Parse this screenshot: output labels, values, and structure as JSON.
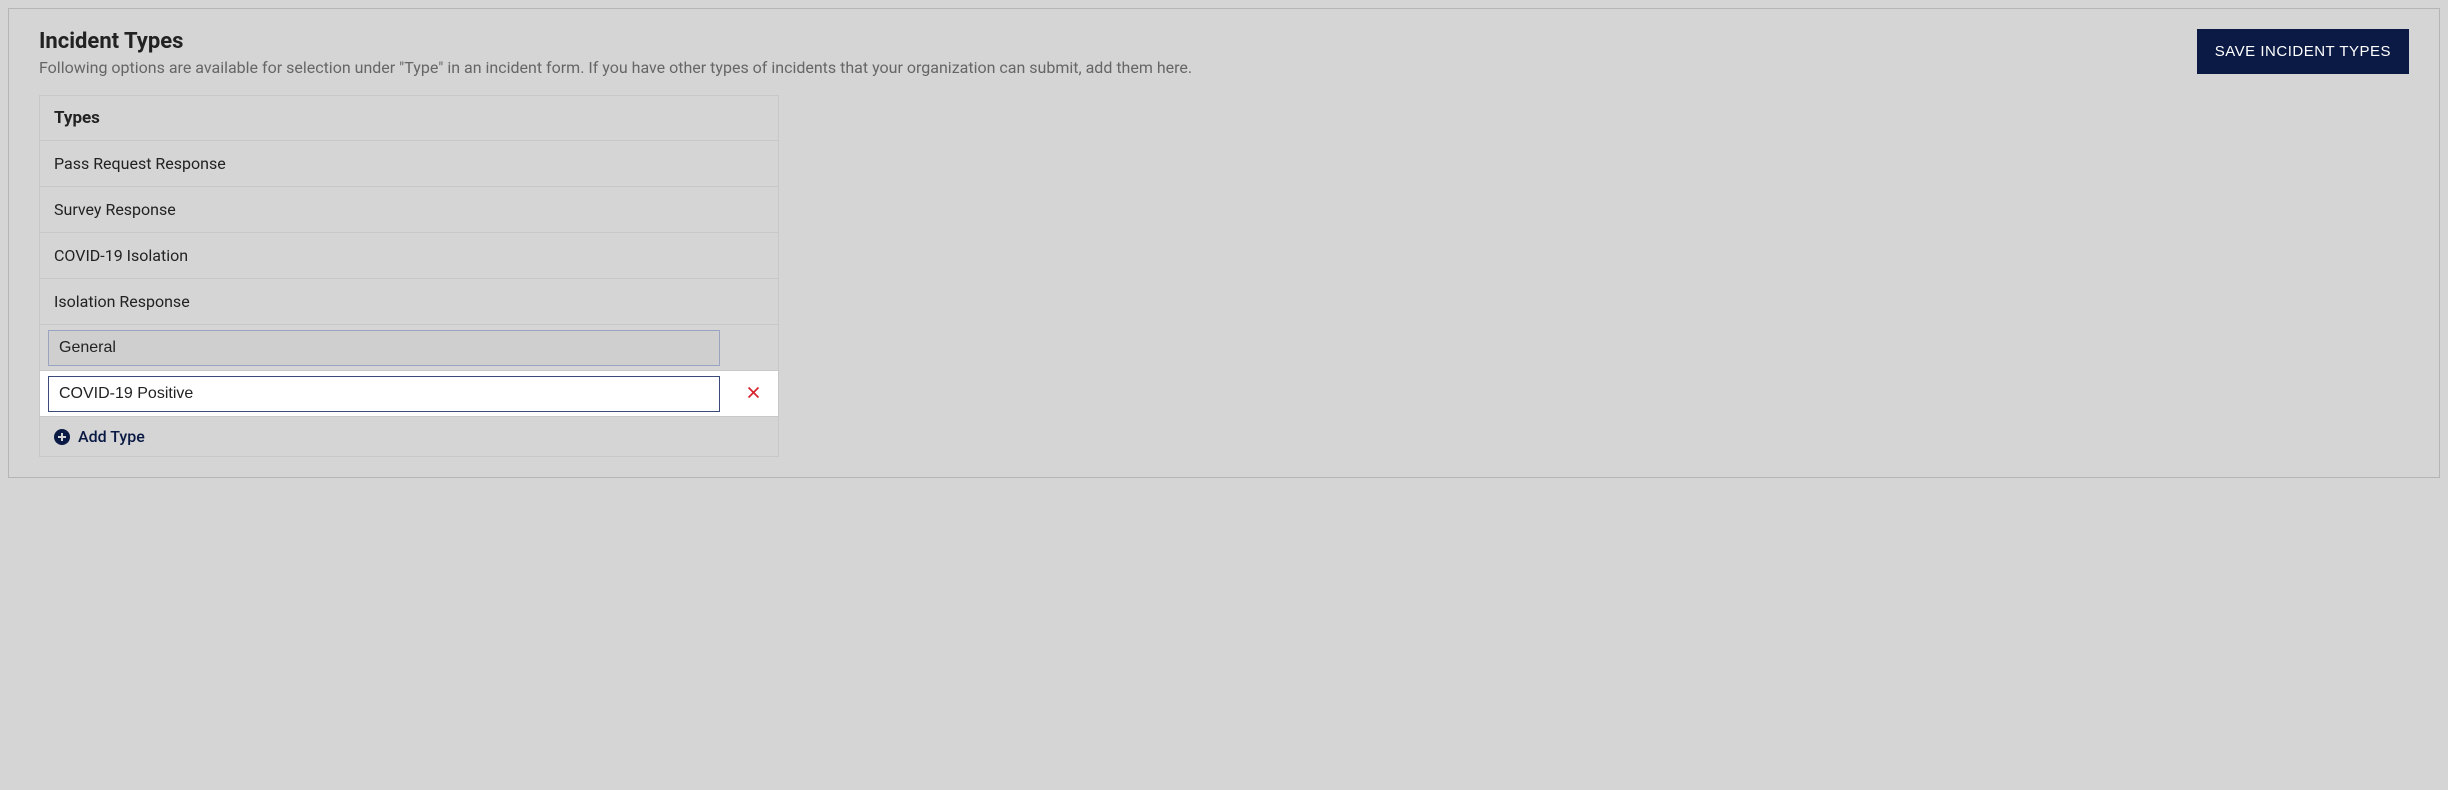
{
  "header": {
    "title": "Incident Types",
    "subtitle": "Following options are available for selection under \"Type\" in an incident form. If you have other types of incidents that your organization can submit, add them here.",
    "save_button": "SAVE INCIDENT TYPES"
  },
  "table": {
    "header": "Types",
    "rows": [
      {
        "label": "Pass Request Response",
        "mode": "static"
      },
      {
        "label": "Survey Response",
        "mode": "static"
      },
      {
        "label": "COVID-19 Isolation",
        "mode": "static"
      },
      {
        "label": "Isolation Response",
        "mode": "static"
      },
      {
        "label": "General",
        "mode": "input"
      },
      {
        "label": "COVID-19 Positive",
        "mode": "editing"
      }
    ],
    "add_label": "Add Type"
  }
}
